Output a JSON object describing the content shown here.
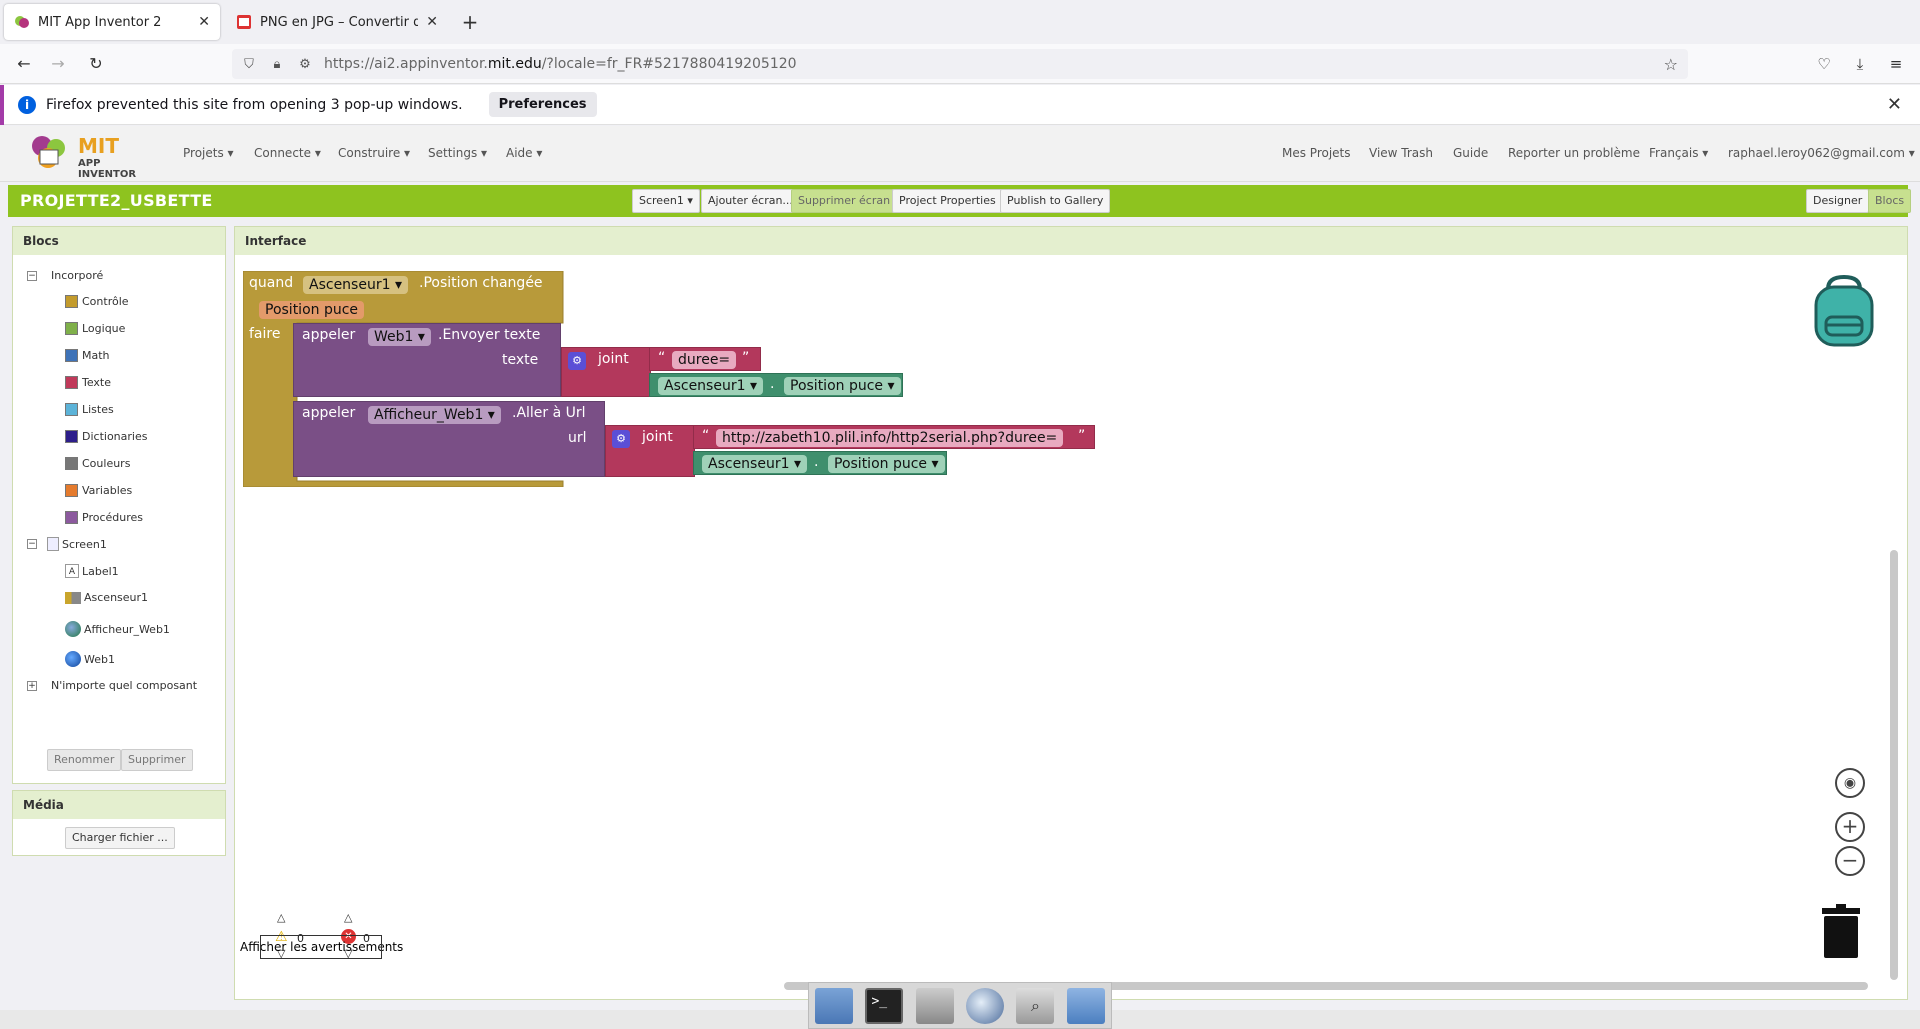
{
  "browser": {
    "tabs": [
      {
        "label": "MIT App Inventor 2",
        "active": true
      },
      {
        "label": "PNG en JPG – Convertir d",
        "active": false
      }
    ],
    "url_prefix": "https://ai2.appinventor.",
    "url_domain": "mit.edu",
    "url_suffix": "/?locale=fr_FR#5217880419205120",
    "popup_message": "Firefox prevented this site from opening 3 pop-up windows.",
    "popup_button": "Preferences"
  },
  "appinventor": {
    "logo_title": "MIT",
    "logo_sub": "APP INVENTOR",
    "menu_left": [
      "Projets ▾",
      "Connecte ▾",
      "Construire ▾",
      "Settings ▾",
      "Aide ▾"
    ],
    "menu_right": [
      "Mes Projets",
      "View Trash",
      "Guide",
      "Reporter un problème",
      "Français ▾",
      "raphael.leroy062@gmail.com ▾"
    ],
    "project_title": "PROJETTE2_USBETTE",
    "toolbar": {
      "screen": "Screen1 ▾",
      "add_screen": "Ajouter écran...",
      "remove_screen": "Supprimer écran",
      "properties": "Project Properties",
      "publish": "Publish to Gallery",
      "designer": "Designer",
      "blocks": "Blocs"
    }
  },
  "blocks_panel": {
    "title": "Blocs",
    "builtin_label": "Incorporé",
    "builtin": [
      {
        "label": "Contrôle",
        "color": "#c39b2c"
      },
      {
        "label": "Logique",
        "color": "#7fb04a"
      },
      {
        "label": "Math",
        "color": "#3f73b8"
      },
      {
        "label": "Texte",
        "color": "#c0395a"
      },
      {
        "label": "Listes",
        "color": "#5cb3d8"
      },
      {
        "label": "Dictionaries",
        "color": "#2d1e8a"
      },
      {
        "label": "Couleurs",
        "color": "#777777"
      },
      {
        "label": "Variables",
        "color": "#e57b2d"
      },
      {
        "label": "Procédures",
        "color": "#8c5a9e"
      }
    ],
    "screen_label": "Screen1",
    "components": [
      "Label1",
      "Ascenseur1",
      "Afficheur_Web1",
      "Web1"
    ],
    "any_component": "N'importe quel composant",
    "rename": "Renommer",
    "delete": "Supprimer"
  },
  "media_panel": {
    "title": "Média",
    "upload": "Charger fichier ..."
  },
  "workspace": {
    "title": "Interface",
    "event": {
      "when": "quand",
      "component": "Ascenseur1",
      "event_name": ".Position changée",
      "param": "Position puce",
      "do": "faire"
    },
    "call1": {
      "call": "appeler",
      "component": "Web1",
      "method": ".Envoyer texte",
      "arg_label": "texte",
      "join": "joint",
      "quote_open": "“",
      "quote_close": "”",
      "text": "duree=",
      "getter_component": "Ascenseur1",
      "getter_dot": ".",
      "getter_prop": "Position puce"
    },
    "call2": {
      "call": "appeler",
      "component": "Afficheur_Web1",
      "method": ".Aller à Url",
      "arg_label": "url",
      "join": "joint",
      "quote_open": "“",
      "quote_close": "”",
      "text": "http://zabeth10.plil.info/http2serial.php?duree=",
      "getter_component": "Ascenseur1",
      "getter_dot": ".",
      "getter_prop": "Position puce"
    },
    "warnings_count": "0",
    "errors_count": "0",
    "show_warnings": "Afficher les avertissements"
  },
  "colors": {
    "event_block": "#b89a3a",
    "procedure_block": "#7a4f86",
    "text_block": "#b3385c",
    "getter_block": "#3f8f6d",
    "app_green": "#8ec31f"
  }
}
